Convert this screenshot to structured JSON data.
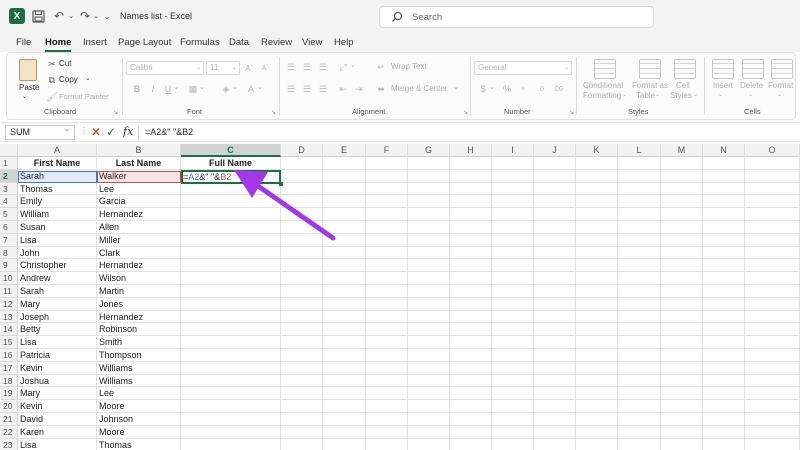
{
  "titlebar": {
    "file_title": "Names list  -  Excel",
    "search_placeholder": "Search",
    "app_icon_letter": "X"
  },
  "menu": {
    "tabs": [
      "File",
      "Home",
      "Insert",
      "Page Layout",
      "Formulas",
      "Data",
      "Review",
      "View",
      "Help"
    ],
    "active": "Home"
  },
  "ribbon": {
    "clipboard": {
      "paste": "Paste",
      "cut": "Cut",
      "copy": "Copy",
      "format_painter": "Format Painter",
      "label": "Clipboard"
    },
    "font": {
      "name": "Calibri",
      "size": "11",
      "label": "Font",
      "bold": "B",
      "italic": "I",
      "underline": "U"
    },
    "alignment": {
      "wrap_text": "Wrap Text",
      "merge_center": "Merge & Center",
      "label": "Alignment"
    },
    "number": {
      "format": "General",
      "currency": "$",
      "percent": "%",
      "label": "Number"
    },
    "styles": {
      "conditional_1": "Conditional",
      "conditional_2": "Formatting",
      "format_as_1": "Format as",
      "format_as_2": "Table",
      "cell_1": "Cell",
      "cell_2": "Styles",
      "label": "Styles"
    },
    "cells": {
      "insert": "Insert",
      "delete": "Delete",
      "format": "Format",
      "label": "Cells"
    }
  },
  "formula_bar": {
    "name_box": "SUM",
    "fx": "fx",
    "formula": "=A2&\" \"&B2"
  },
  "sheet": {
    "columns": [
      "A",
      "B",
      "C",
      "D",
      "E",
      "F",
      "G",
      "H",
      "I",
      "J",
      "K",
      "L",
      "M",
      "N",
      "O"
    ],
    "row_numbers": [
      "1",
      "2",
      "3",
      "4",
      "5",
      "6",
      "7",
      "8",
      "9",
      "10",
      "11",
      "12",
      "13",
      "14",
      "15",
      "16",
      "17",
      "18",
      "19",
      "20",
      "21",
      "22",
      "23"
    ],
    "headers": [
      "First Name",
      "Last Name",
      "Full Name"
    ],
    "rows": [
      [
        "Sarah",
        "Walker"
      ],
      [
        "Thomas",
        "Lee"
      ],
      [
        "Emily",
        "Garcia"
      ],
      [
        "William",
        "Hernandez"
      ],
      [
        "Susan",
        "Allen"
      ],
      [
        "Lisa",
        "Miller"
      ],
      [
        "John",
        "Clark"
      ],
      [
        "Christopher",
        "Hernandez"
      ],
      [
        "Andrew",
        "Wilson"
      ],
      [
        "Sarah",
        "Martin"
      ],
      [
        "Mary",
        "Jones"
      ],
      [
        "Joseph",
        "Hernandez"
      ],
      [
        "Betty",
        "Robinson"
      ],
      [
        "Lisa",
        "Smith"
      ],
      [
        "Patricia",
        "Thompson"
      ],
      [
        "Kevin",
        "Williams"
      ],
      [
        "Joshua",
        "Williams"
      ],
      [
        "Mary",
        "Lee"
      ],
      [
        "Kevin",
        "Moore"
      ],
      [
        "David",
        "Johnson"
      ],
      [
        "Karen",
        "Moore"
      ],
      [
        "Lisa",
        "Thomas"
      ]
    ],
    "editing_cell": {
      "ref1": "A2",
      "sep": "&\" \"&",
      "ref2": "B2",
      "eq": "="
    },
    "selected_column": "C",
    "selected_row": "2"
  },
  "colors": {
    "accent": "#1d6f42",
    "ref1": "#4472c4",
    "ref2": "#c0504d",
    "arrow": "#a238e8"
  }
}
